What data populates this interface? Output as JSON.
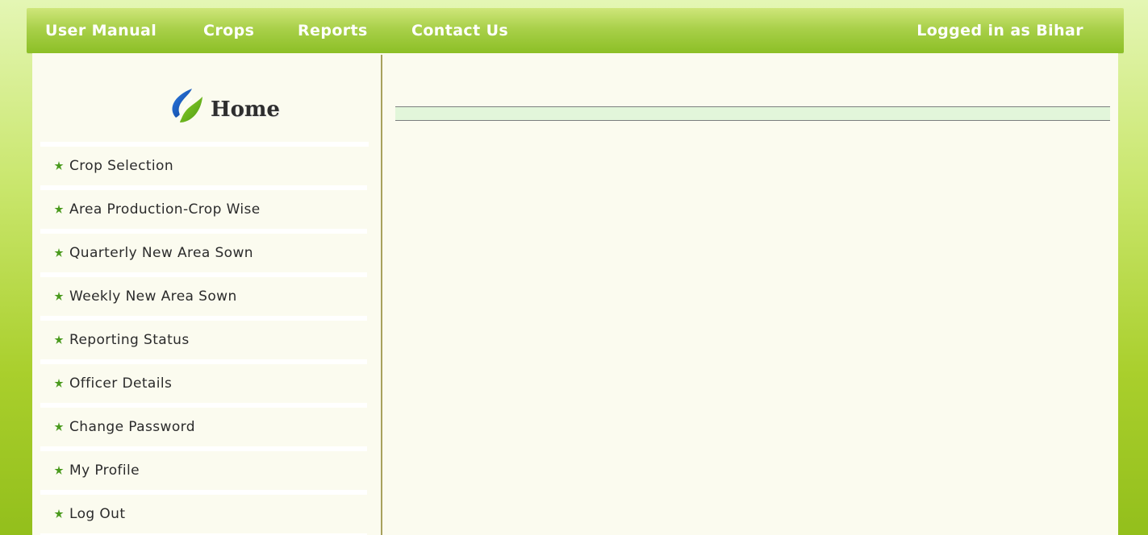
{
  "topbar": {
    "nav": [
      {
        "label": "User Manual"
      },
      {
        "label": "Crops"
      },
      {
        "label": "Reports"
      },
      {
        "label": "Contact Us"
      }
    ],
    "login_status": "Logged in as Bihar"
  },
  "sidebar": {
    "home_label": "Home",
    "menu": [
      {
        "label": "Crop Selection"
      },
      {
        "label": "Area Production-Crop Wise"
      },
      {
        "label": "Quarterly New Area Sown"
      },
      {
        "label": "Weekly New Area Sown"
      },
      {
        "label": "Reporting Status"
      },
      {
        "label": "Officer Details"
      },
      {
        "label": "Change Password"
      },
      {
        "label": "My Profile"
      },
      {
        "label": "Log Out"
      }
    ]
  },
  "colors": {
    "topbar": "#9fcb3a",
    "menu_icon": "#4a9a1d",
    "divider": "#a7a15c",
    "content_bar": "#e2f6da"
  },
  "icons": {
    "home_logo": "leaf-logo-icon",
    "menu_bullet": "star-bullet-icon"
  }
}
